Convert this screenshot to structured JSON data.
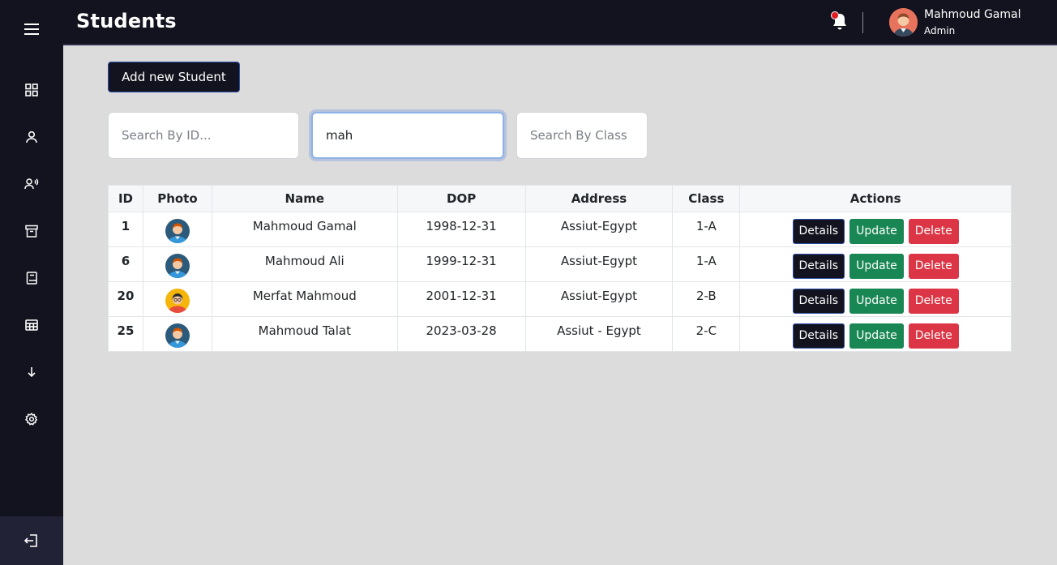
{
  "header": {
    "title": "Students",
    "user_name": "Mahmoud Gamal",
    "user_role": "Admin"
  },
  "sidebar": {
    "items": [
      {
        "icon": "menu-icon"
      },
      {
        "icon": "dashboard-icon"
      },
      {
        "icon": "user-icon"
      },
      {
        "icon": "users-voice-icon"
      },
      {
        "icon": "archive-icon"
      },
      {
        "icon": "book-icon"
      },
      {
        "icon": "table-icon"
      },
      {
        "icon": "arrow-down-icon"
      },
      {
        "icon": "gear-icon"
      },
      {
        "icon": "logout-icon"
      }
    ]
  },
  "toolbar": {
    "add_label": "Add new Student"
  },
  "search": {
    "id_placeholder": "Search By ID...",
    "name_value": "mah",
    "class_placeholder": "Search By Class"
  },
  "table": {
    "headers": [
      "ID",
      "Photo",
      "Name",
      "DOP",
      "Address",
      "Class",
      "Actions"
    ],
    "rows": [
      {
        "id": "1",
        "name": "Mahmoud Gamal",
        "dop": "1998-12-31",
        "address": "Assiut-Egypt",
        "class": "1-A",
        "avatar": "male"
      },
      {
        "id": "6",
        "name": "Mahmoud Ali",
        "dop": "1999-12-31",
        "address": "Assiut-Egypt",
        "class": "1-A",
        "avatar": "male"
      },
      {
        "id": "20",
        "name": "Merfat Mahmoud",
        "dop": "2001-12-31",
        "address": "Assiut-Egypt",
        "class": "2-B",
        "avatar": "female"
      },
      {
        "id": "25",
        "name": "Mahmoud Talat",
        "dop": "2023-03-28",
        "address": "Assiut - Egypt",
        "class": "2-C",
        "avatar": "male"
      }
    ],
    "actions": {
      "details": "Details",
      "update": "Update",
      "delete": "Delete"
    }
  },
  "colors": {
    "sidebar_bg": "#13131f",
    "content_bg": "#dcdcdc",
    "details": "#13131f",
    "update": "#198754",
    "delete": "#dc3545",
    "notification": "#e01b24"
  }
}
